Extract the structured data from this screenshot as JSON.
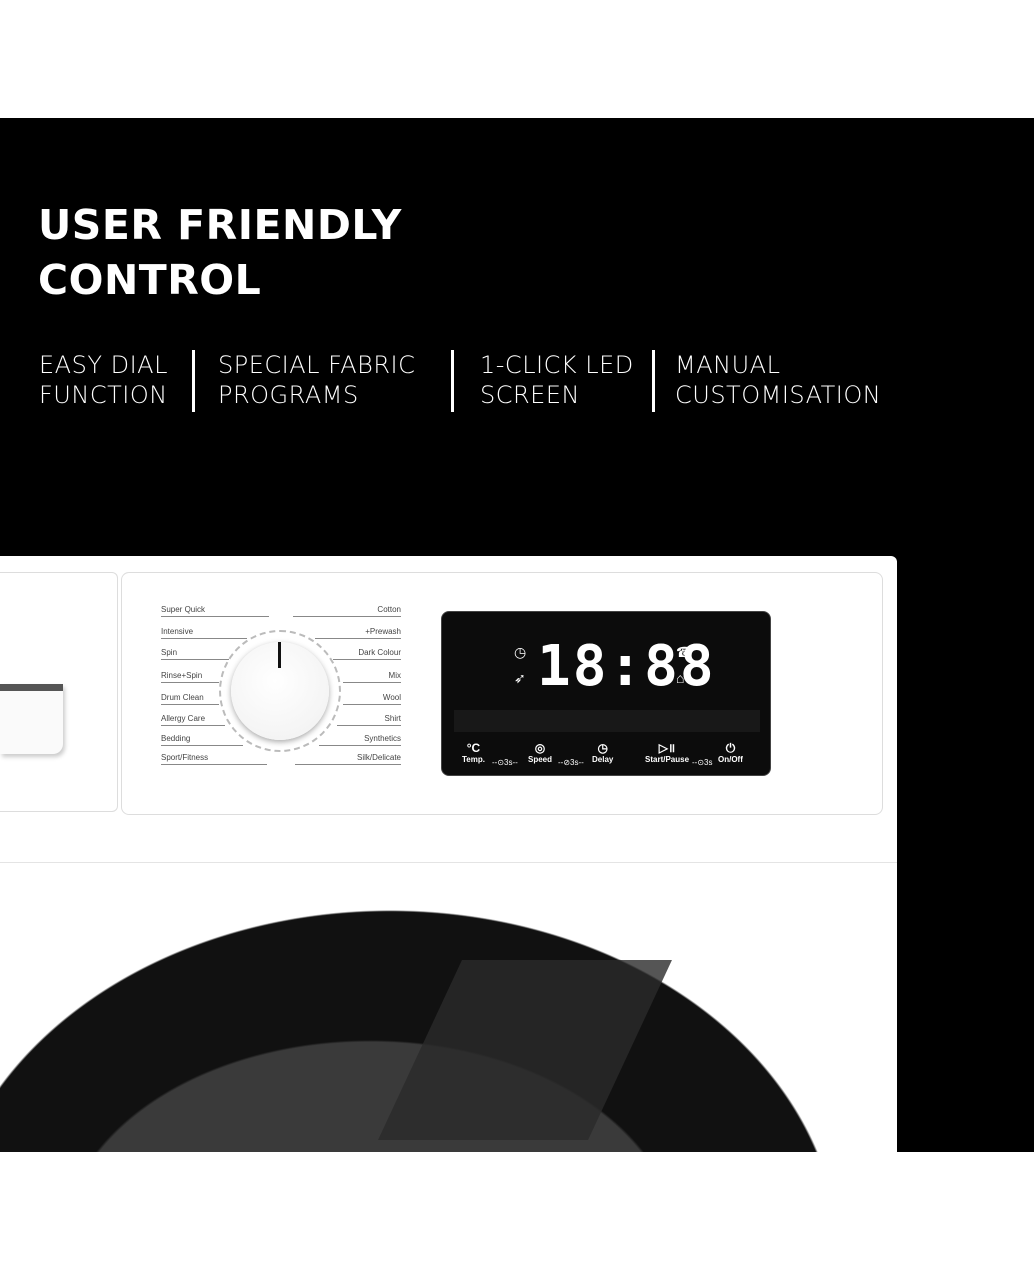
{
  "headline": "USER FRIENDLY CONTROL",
  "features": [
    {
      "line1": "EASY DIAL",
      "line2": "FUNCTION"
    },
    {
      "line1": "SPECIAL FABRIC",
      "line2": "PROGRAMS"
    },
    {
      "line1": "1-CLICK LED",
      "line2": "SCREEN"
    },
    {
      "line1": "MANUAL",
      "line2": "CUSTOMISATION"
    }
  ],
  "programs_left": [
    "Super Quick",
    "Intensive",
    "Spin",
    "Rinse+Spin",
    "Drum Clean",
    "Allergy Care",
    "Bedding",
    "Sport/Fitness"
  ],
  "programs_right": [
    "Cotton",
    "+Prewash",
    "Dark Colour",
    "Mix",
    "Wool",
    "Shirt",
    "Synthetics",
    "Silk/Delicate"
  ],
  "display": {
    "digits": "18:88"
  },
  "buttons": [
    {
      "label": "Temp.",
      "icon": "°C"
    },
    {
      "label": "Speed",
      "icon": "◎"
    },
    {
      "label": "Delay",
      "icon": "◷"
    },
    {
      "label": "Start/Pause",
      "icon": "▷॥"
    },
    {
      "label": "On/Off",
      "icon": "⏻"
    }
  ],
  "locks": [
    "--⊙3s--",
    "--⊘3s--",
    "--⊙3s"
  ]
}
